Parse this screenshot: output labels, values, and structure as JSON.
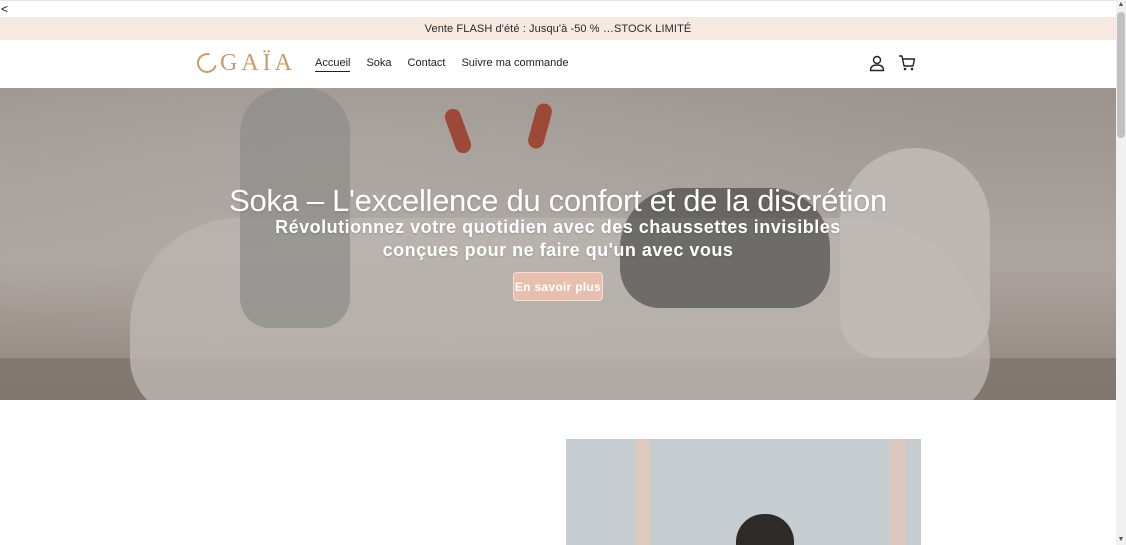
{
  "browser": {
    "back_label": "<"
  },
  "announcement": {
    "text": "Vente FLASH d'été : Jusqu'à -50 % …STOCK LIMITÉ"
  },
  "header": {
    "logo_text": "GAÏA",
    "nav": [
      {
        "label": "Accueil",
        "active": true
      },
      {
        "label": "Soka",
        "active": false
      },
      {
        "label": "Contact",
        "active": false
      },
      {
        "label": "Suivre ma commande",
        "active": false
      }
    ],
    "icons": [
      "account-icon",
      "cart-icon"
    ]
  },
  "hero": {
    "title": "Soka – L'excellence du confort et de la discrétion",
    "subtitle": "Révolutionnez votre quotidien avec des chaussettes invisibles conçues pour ne faire qu'un avec vous",
    "button_label": "En savoir plus"
  },
  "colors": {
    "announcement_bg": "#f7e9e0",
    "brand": "#c99a6d",
    "button_bg": "#e8bfae"
  }
}
